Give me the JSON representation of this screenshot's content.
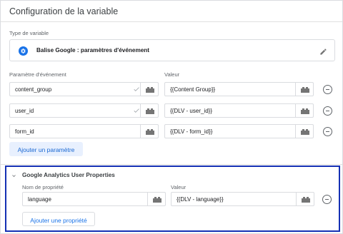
{
  "header": {
    "title": "Configuration de la variable"
  },
  "variable_type": {
    "label": "Type de variable",
    "value": "Balise Google : paramètres d'événement",
    "icon": "gear-icon",
    "edit_icon": "pencil-icon"
  },
  "event_params": {
    "name_header": "Paramètre d'événement",
    "value_header": "Valeur",
    "rows": [
      {
        "name": "content_group",
        "value": "{{Content Group}}"
      },
      {
        "name": "user_id",
        "value": "{{DLV - user_id}}"
      },
      {
        "name": "form_id",
        "value": "{{DLV - form_id}}"
      }
    ],
    "add_button": "Ajouter un paramètre"
  },
  "user_properties": {
    "title": "Google Analytics User Properties",
    "name_header": "Nom de propriété",
    "value_header": "Valeur",
    "rows": [
      {
        "name": "language",
        "value": "{{DLV - language}}"
      }
    ],
    "add_button": "Ajouter une propriété"
  },
  "colors": {
    "accent": "#1a73e8",
    "button_bg": "#e8f0fe",
    "highlight_border": "#1530b4"
  }
}
